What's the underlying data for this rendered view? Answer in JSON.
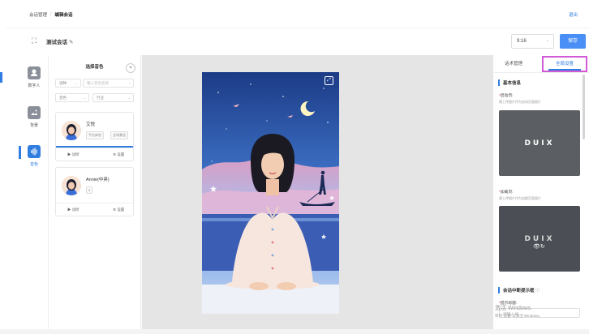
{
  "breadcrumb": {
    "parent": "会话管理",
    "separator": "/",
    "current": "编辑会话"
  },
  "header": {
    "exit_label": "退出"
  },
  "titlebar": {
    "title": "测试会话",
    "ratio": "9:16",
    "save_label": "保存"
  },
  "rail": {
    "items": [
      {
        "label": "数字人",
        "icon": "person-icon"
      },
      {
        "label": "背景",
        "icon": "image-icon"
      },
      {
        "label": "音色",
        "icon": "voice-icon",
        "active": true
      }
    ]
  },
  "voice_panel": {
    "title": "选择音色",
    "filters": {
      "lang": "语种",
      "search_placeholder": "输入音色名称",
      "gender": "音色",
      "industry": "行业"
    },
    "cards": [
      {
        "name": "艾悦",
        "tags": [
          "平台体验",
          "全场景适"
        ],
        "listen": "试听",
        "setting": "设置"
      },
      {
        "name": "Annie(中英)",
        "tags": [
          "0"
        ],
        "listen": "试听",
        "setting": "设置"
      }
    ]
  },
  "right_panel": {
    "tab_speech": "话术管理",
    "tab_global": "全局设置",
    "section_basic": "基本信息",
    "start_label": "启动页:",
    "start_hint": "建上传图片作为启动页面图片",
    "loading_label": "加载页:",
    "loading_hint": "建上传图片作为加载页面图片",
    "logo_text": "DUIX",
    "section_interrupt": "会话中断提示框",
    "prompt_title_label": "提示标题:",
    "prompt_placeholder": "请输入标"
  },
  "watermark": {
    "line1": "激活 Windows",
    "line2": "转到\"设置\"以激活 Windows。"
  }
}
